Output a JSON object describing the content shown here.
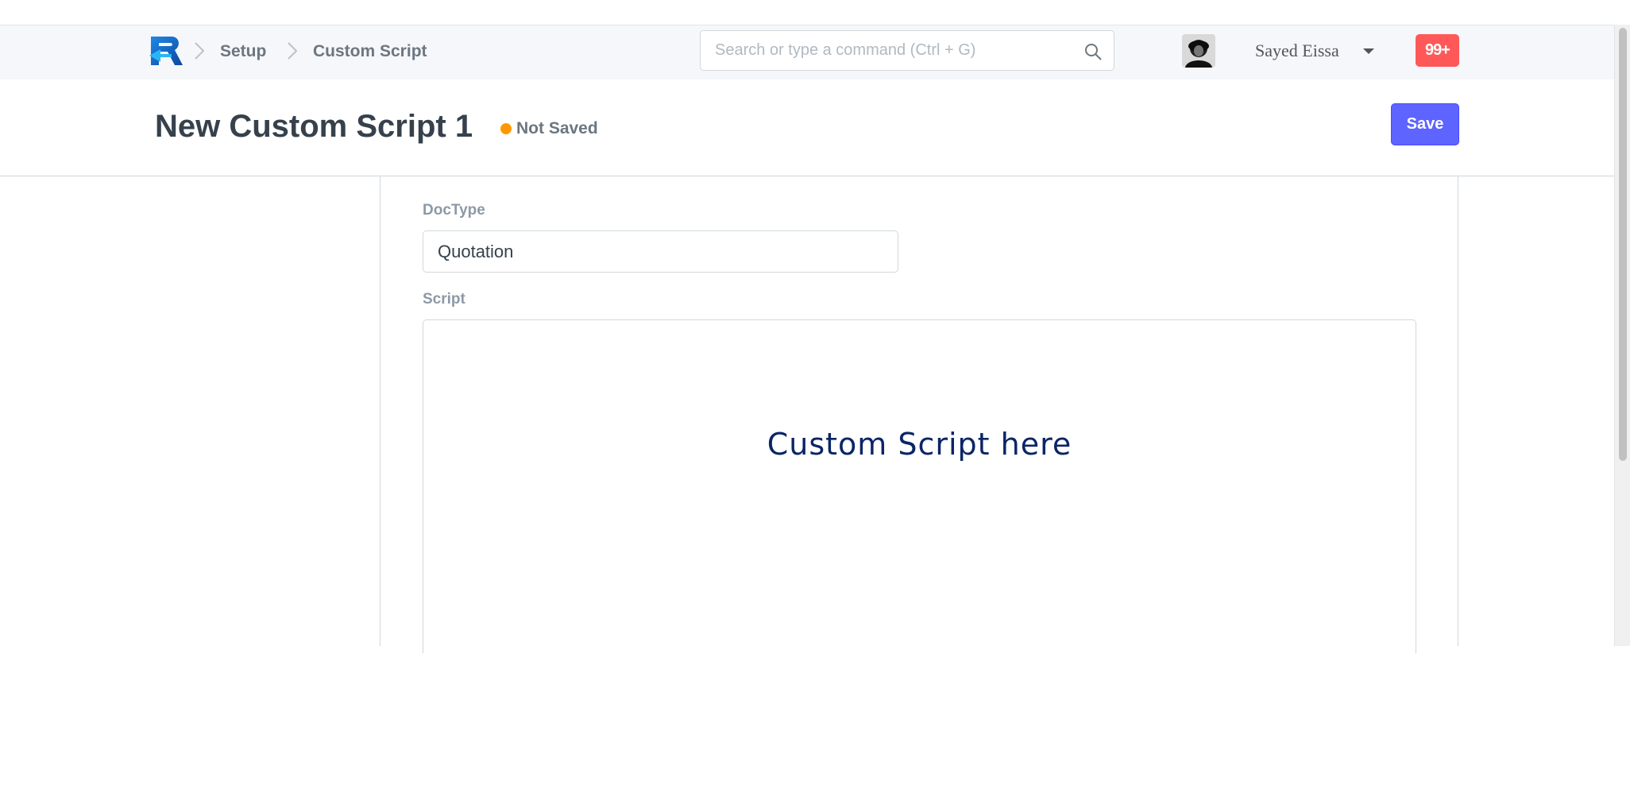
{
  "navbar": {
    "breadcrumbs": [
      "Setup",
      "Custom Script"
    ],
    "search_placeholder": "Search or type a command (Ctrl + G)",
    "user_name": "Sayed Eissa",
    "notification_count": "99+",
    "logo_icon": "frappe-r-logo"
  },
  "page": {
    "title": "New Custom Script 1",
    "status": "Not Saved",
    "status_color": "#ff9800",
    "save_label": "Save",
    "accent": "#5e64ff"
  },
  "form": {
    "doctype_label": "DocType",
    "doctype_value": "Quotation",
    "script_label": "Script",
    "script_text": "Custom Script here"
  }
}
